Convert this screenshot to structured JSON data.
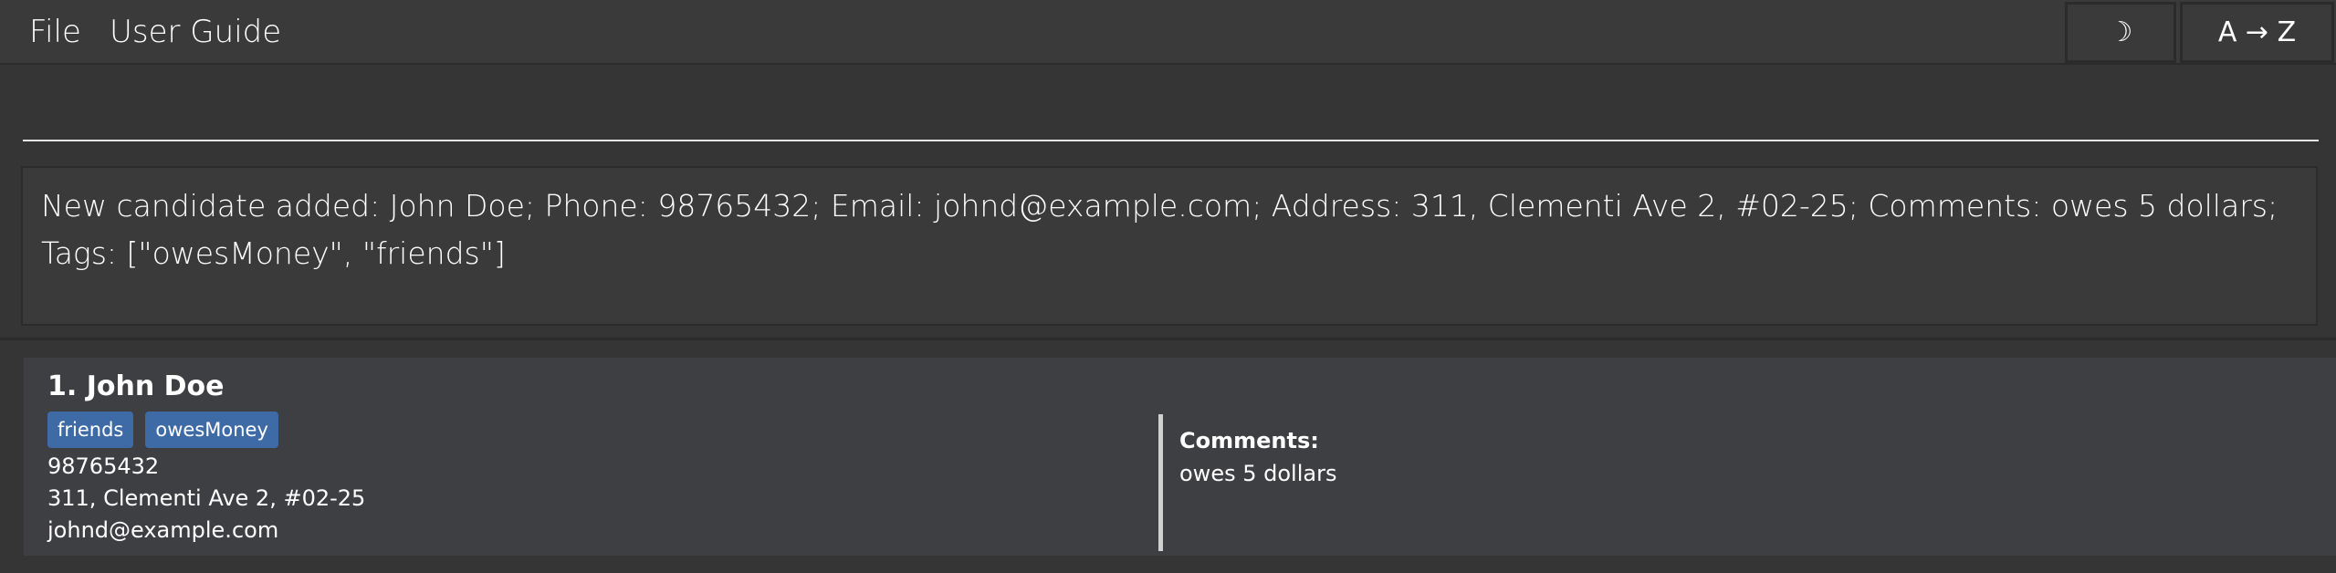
{
  "menu": {
    "file": "File",
    "user_guide": "User Guide"
  },
  "toolbar": {
    "theme_toggle": "☽",
    "sort": "A → Z"
  },
  "command": {
    "value": "",
    "placeholder": ""
  },
  "result": {
    "message": "New candidate added: John Doe; Phone: 98765432; Email: johnd@example.com; Address: 311, Clementi Ave 2, #02-25; Comments: owes 5 dollars; Tags: [\"owesMoney\", \"friends\"]"
  },
  "persons": [
    {
      "index_name": "1. John Doe",
      "tags": [
        "friends",
        "owesMoney"
      ],
      "phone": "98765432",
      "address": "311, Clementi Ave 2, #02-25",
      "email": "johnd@example.com",
      "comments_label": "Comments:",
      "comments": "owes 5 dollars"
    }
  ],
  "colors": {
    "background": "#3a3a3a",
    "card": "#3e3f43",
    "tag": "#3e6ba6"
  }
}
